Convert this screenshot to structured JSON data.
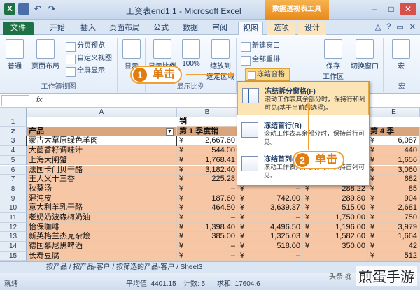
{
  "title": "工资表end1:1 - Microsoft Excel",
  "context_tab_title": "数据透视表工具",
  "tabs": [
    "文件",
    "开始",
    "插入",
    "页面布局",
    "公式",
    "数据",
    "审阅",
    "视图",
    "选项",
    "设计"
  ],
  "ribbon": {
    "workbook_views": {
      "label": "工作簿视图",
      "normal": "普通",
      "page_layout": "页面布局",
      "page_break": "分页预览",
      "custom": "自定义视图",
      "fullscreen": "全屏显示"
    },
    "show": {
      "label": "显示"
    },
    "zoom": {
      "label": "显示比例",
      "zoom": "显示比例",
      "hundred": "100%",
      "zoom_sel1": "缩放到",
      "zoom_sel2": "选定区域"
    },
    "window": {
      "new_window": "新建窗口",
      "arrange_all": "全部重排",
      "freeze": "冻结窗格",
      "save_workspace1": "保存",
      "save_workspace2": "工作区",
      "switch_windows": "切换窗口"
    },
    "macros": {
      "label": "宏",
      "macro": "宏"
    }
  },
  "formula_bar": {
    "fx": "fx"
  },
  "columns": [
    "A",
    "B",
    "C",
    "D",
    "E"
  ],
  "header_row": {
    "name": "产品",
    "b_top": "销",
    "b": "第 1 季度销",
    "e": "第 4 季"
  },
  "rows": [
    {
      "n": "3",
      "name": "蒙古大草原绿色羊肉",
      "b": "2,667.60",
      "c": "",
      "d": "",
      "e": "6,087"
    },
    {
      "n": "4",
      "name": "大茴香籽调味汁",
      "b": "544.00",
      "c": "",
      "d": "",
      "e": "440"
    },
    {
      "n": "5",
      "name": "上海大闸蟹",
      "b": "1,768.41",
      "c": "",
      "d": "",
      "e": "1,656"
    },
    {
      "n": "6",
      "name": "法国卡门贝干酪",
      "b": "3,182.40",
      "c": "",
      "d": "",
      "e": "3,060"
    },
    {
      "n": "7",
      "name": "王大义十三香",
      "b": "225.28",
      "c": "",
      "d": "",
      "e": "682"
    },
    {
      "n": "8",
      "name": "秋葵汤",
      "b": "–",
      "c": "–",
      "d": "288.22",
      "e": "85"
    },
    {
      "n": "9",
      "name": "混沌皮",
      "b": "187.60",
      "c": "742.00",
      "d": "289.80",
      "e": "904"
    },
    {
      "n": "10",
      "name": "意大利羊乳干酪",
      "b": "464.50",
      "c": "3,639.37",
      "d": "515.00",
      "e": "2,681"
    },
    {
      "n": "11",
      "name": "老奶奶波森梅奶油",
      "b": "–",
      "c": "–",
      "d": "1,750.00",
      "e": "750"
    },
    {
      "n": "12",
      "name": "怡保咖啡",
      "b": "1,398.40",
      "c": "4,496.50",
      "d": "1,196.00",
      "e": "3,979"
    },
    {
      "n": "13",
      "name": "新英格兰杰克杂烩",
      "b": "385.00",
      "c": "1,325.03",
      "d": "1,582.60",
      "e": "1,664"
    },
    {
      "n": "14",
      "name": "德国慕尼黑啤酒",
      "b": "–",
      "c": "518.00",
      "d": "350.00",
      "e": "42"
    },
    {
      "n": "15",
      "name": "长寿豆腐",
      "b": "–",
      "c": "–",
      "d": "",
      "e": "512"
    }
  ],
  "currency": "¥",
  "dropdown": {
    "items": [
      {
        "title": "冻结拆分窗格(F)",
        "desc": "滚动工作表其余部分时，保持行和列可见(基于当前的选择)。"
      },
      {
        "title": "冻结首行(R)",
        "desc": "滚动工作表其余部分时，保持首行可见。"
      },
      {
        "title": "冻结首列(C)",
        "desc": "滚动工作表其余部分时，保持首列可见。"
      }
    ]
  },
  "callouts": [
    {
      "num": "1",
      "text": "单击"
    },
    {
      "num": "2",
      "text": "单击"
    }
  ],
  "sheet_tabs": "按产品 / 按产品-客户 / 按筛选的产品-客户 / Sheet3",
  "status": {
    "ready": "就绪",
    "avg": "平均值: 4401.15",
    "count": "计数: 5",
    "sum": "求和: 17604.6"
  },
  "watermark": "煎蛋手游",
  "watermark_small": "头条 @"
}
